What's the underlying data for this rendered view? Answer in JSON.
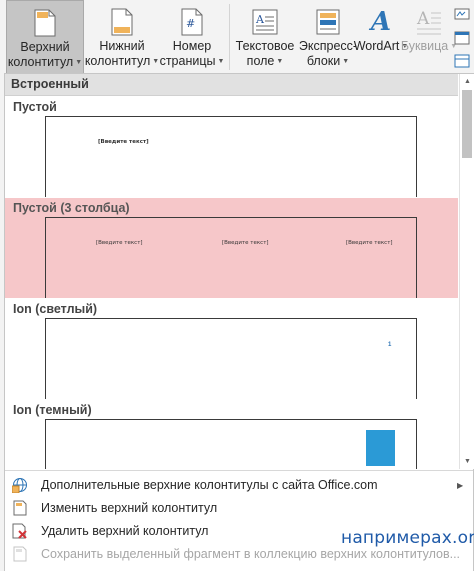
{
  "ribbon": {
    "buttons": [
      {
        "line1": "Верхний",
        "line2": "колонтитул",
        "icon": "header-page-icon",
        "active": true
      },
      {
        "line1": "Нижний",
        "line2": "колонтитул",
        "icon": "footer-page-icon"
      },
      {
        "line1": "Номер",
        "line2": "страницы",
        "icon": "page-number-icon"
      },
      {
        "line1": "Текстовое",
        "line2": "поле",
        "icon": "text-box-icon"
      },
      {
        "line1": "Экспресс-",
        "line2": "блоки",
        "icon": "quick-parts-icon"
      },
      {
        "line1": "WordArt",
        "line2": "",
        "icon": "wordart-icon"
      },
      {
        "line1": "Буквица",
        "line2": "",
        "icon": "drop-cap-icon",
        "disabled": true
      }
    ]
  },
  "gallery": {
    "section_title": "Встроенный",
    "items": [
      {
        "title": "Пустой",
        "placeholders": [
          "[Введите текст]"
        ]
      },
      {
        "title": "Пустой (3 столбца)",
        "placeholders": [
          "[Введите текст]",
          "[Введите текст]",
          "[Введите текст]"
        ],
        "highlighted": true
      },
      {
        "title": "Ion (светлый)",
        "page_number": "1"
      },
      {
        "title": "Ion (темный)"
      }
    ]
  },
  "menu": {
    "items": [
      {
        "label": "Дополнительные верхние колонтитулы с сайта Office.com",
        "icon": "office-globe-icon",
        "has_submenu": true
      },
      {
        "label": "Изменить верхний колонтитул",
        "icon": "edit-header-icon"
      },
      {
        "label": "Удалить верхний колонтитул",
        "icon": "remove-header-icon"
      },
      {
        "label": "Сохранить выделенный фрагмент в коллекцию верхних колонтитулов...",
        "icon": "save-selection-icon",
        "disabled": true
      }
    ]
  },
  "watermark": "напримерах.org",
  "colors": {
    "accent": "#2b579a",
    "hover": "#f6c7c9",
    "active_button": "#c5c5c5",
    "wordart": "#2e75b6"
  }
}
